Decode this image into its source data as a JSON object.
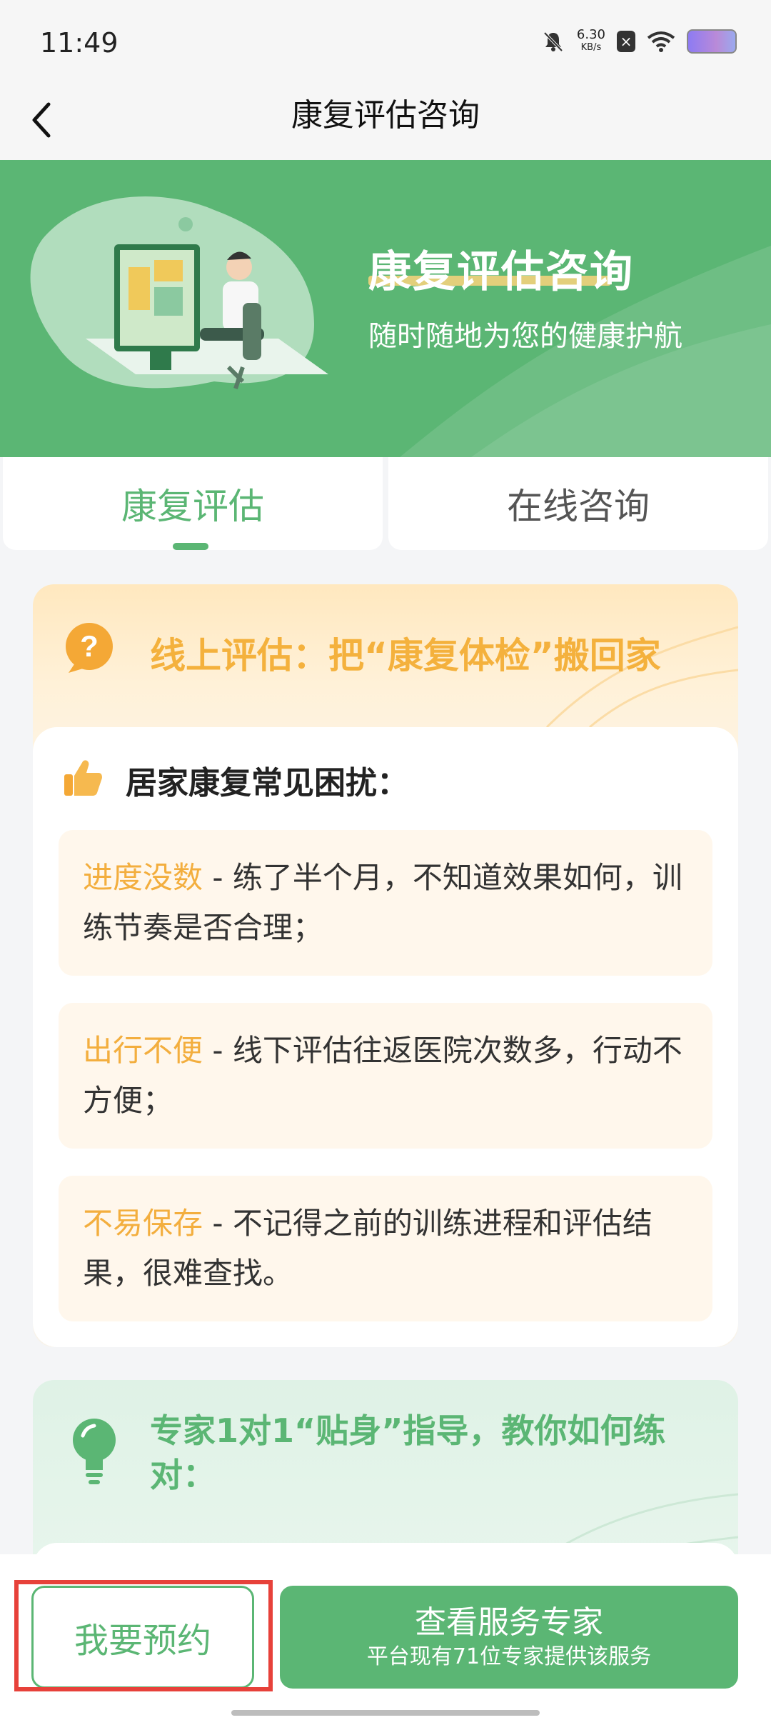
{
  "status_bar": {
    "time": "11:49",
    "net_speed_value": "6.30",
    "net_speed_unit": "KB/s",
    "icons": [
      "bell-muted-icon",
      "sim-off-icon",
      "wifi-icon",
      "battery-icon"
    ]
  },
  "header": {
    "back_icon": "chevron-left-icon",
    "title": "康复评估咨询"
  },
  "banner": {
    "title": "康复评估咨询",
    "subtitle": "随时随地为您的健康护航"
  },
  "tabs": [
    {
      "label": "康复评估",
      "active": true
    },
    {
      "label": "在线咨询",
      "active": false
    }
  ],
  "section1": {
    "icon": "question-icon",
    "title": "线上评估：把“康复体检”搬回家",
    "heading_icon": "thumbs-up-icon",
    "heading": "居家康复常见困扰：",
    "items": [
      {
        "highlight": "进度没数",
        "text": " - 练了半个月，不知道效果如何，训练节奏是否合理；"
      },
      {
        "highlight": "出行不便",
        "text": " - 线下评估往返医院次数多，行动不方便；"
      },
      {
        "highlight": "不易保存",
        "text": " - 不记得之前的训练进程和评估结果，很难查找。"
      }
    ]
  },
  "section2": {
    "icon": "lightbulb-icon",
    "title": "专家1对1“贴身”指导，教你如何练对："
  },
  "bottom": {
    "reserve_label": "我要预约",
    "expert_label": "查看服务专家",
    "expert_sub": "平台现有71位专家提供该服务"
  },
  "colors": {
    "brand_green": "#5bb674",
    "accent_orange": "#f3ae3e",
    "highlight_red": "#e7413a"
  }
}
